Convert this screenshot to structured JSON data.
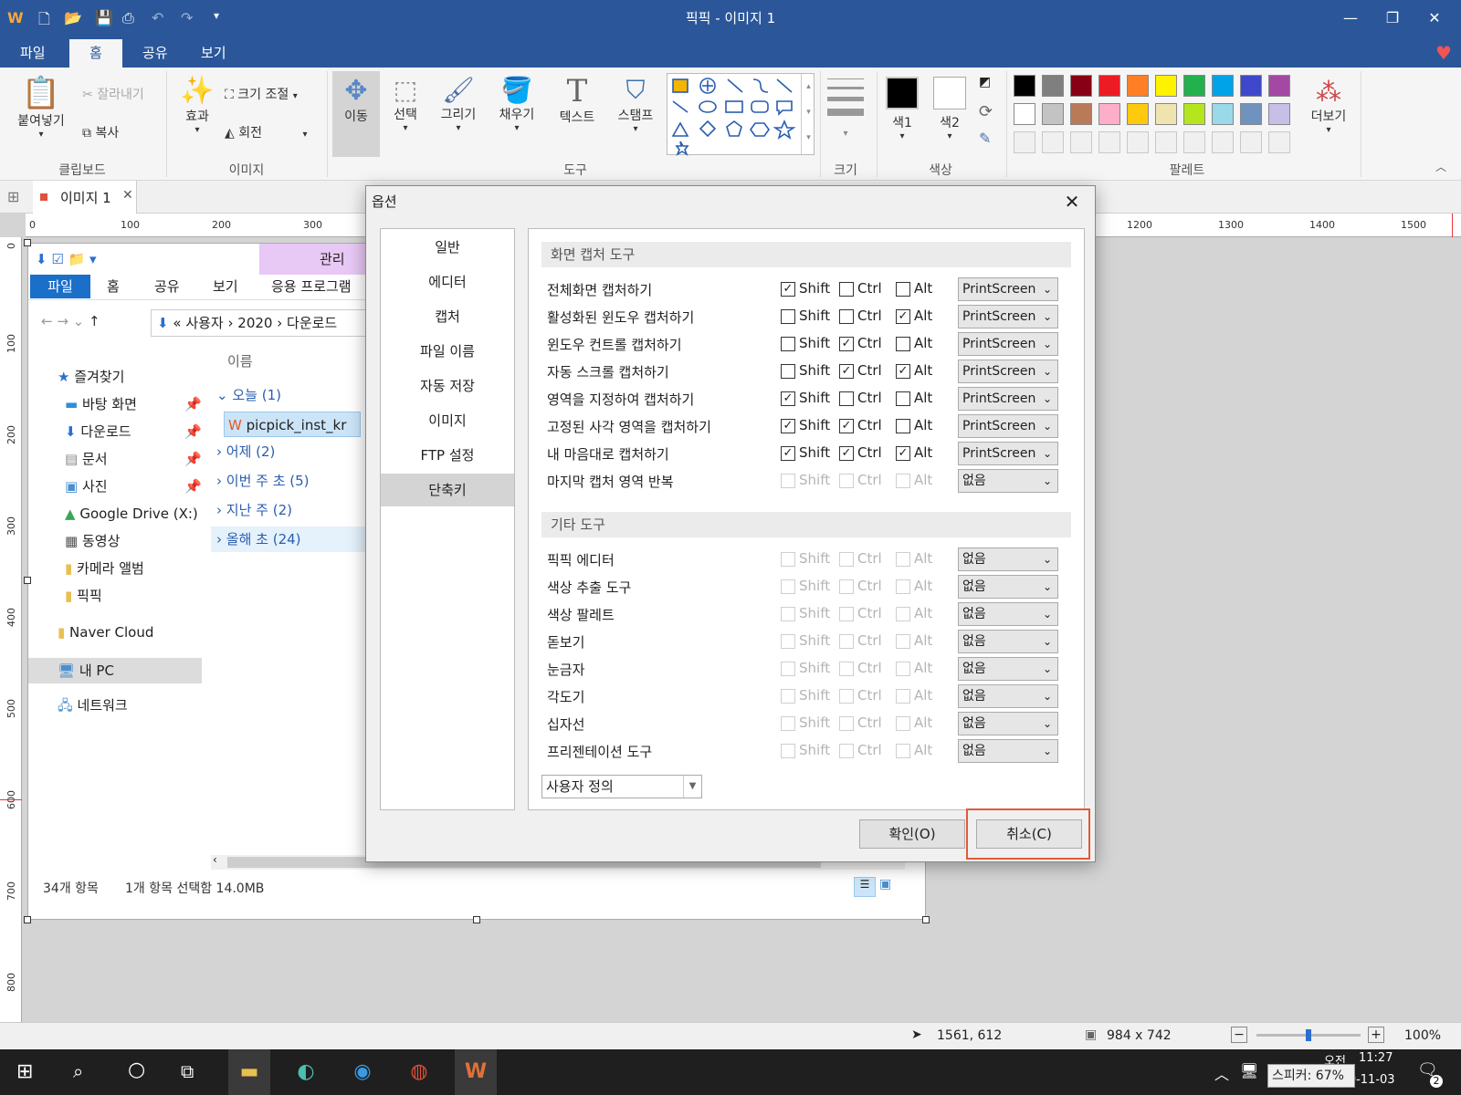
{
  "window": {
    "title": "픽픽 - 이미지 1",
    "minimize": "—",
    "restore": "❐",
    "close": "✕"
  },
  "ribbon_tabs": [
    "파일",
    "홈",
    "공유",
    "보기"
  ],
  "ribbon": {
    "clipboard": {
      "paste": "붙여넣기",
      "cut": "잘라내기",
      "copy": "복사",
      "label": "클립보드"
    },
    "image": {
      "effect": "효과",
      "resize": "크기 조절",
      "rotate": "회전",
      "label": "이미지"
    },
    "tools": {
      "move": "이동",
      "select": "선택",
      "draw": "그리기",
      "fill": "채우기",
      "text": "텍스트",
      "stamp": "스탬프",
      "label": "도구"
    },
    "size": {
      "label": "크기"
    },
    "color": {
      "color1": "색1",
      "color2": "색2",
      "label": "색상"
    },
    "palette": {
      "label": "팔레트",
      "more": "더보기",
      "row1": [
        "#000000",
        "#7f7f7f",
        "#880015",
        "#ed1c24",
        "#ff7f27",
        "#fff200",
        "#22b14c",
        "#00a2e8",
        "#3f48cc",
        "#a349a4"
      ],
      "row2": [
        "#ffffff",
        "#c3c3c3",
        "#b97a57",
        "#ffaec9",
        "#ffc90e",
        "#efe4b0",
        "#b5e61d",
        "#99d9ea",
        "#7092be",
        "#c8bfe7"
      ]
    }
  },
  "doc_tab": {
    "label": "이미지 1"
  },
  "ruler": {
    "h": [
      "0",
      "100",
      "200",
      "300",
      "1200",
      "1300",
      "1400",
      "1500"
    ],
    "v": [
      "0",
      "100",
      "200",
      "300",
      "400",
      "500",
      "600",
      "700",
      "800"
    ]
  },
  "explorer": {
    "context_tab": "관리",
    "tabs": [
      "파일",
      "홈",
      "공유",
      "보기",
      "응용 프로그램"
    ],
    "path": [
      "«",
      "사용자",
      "2020",
      "다운로드"
    ],
    "column": "이름",
    "nav": [
      "즐겨찾기",
      "바탕 화면",
      "다운로드",
      "문서",
      "사진",
      "Google Drive (X:)",
      "동영상",
      "카메라 앨범",
      "픽픽",
      "Naver Cloud",
      "내 PC",
      "네트워크"
    ],
    "groups": [
      "오늘 (1)",
      "어제 (2)",
      "이번 주 초 (5)",
      "지난 주 (2)",
      "올해 초 (24)"
    ],
    "file": "picpick_inst_kr",
    "status_count": "34개 항목",
    "status_sel": "1개 항목 선택함 14.0MB"
  },
  "dialog": {
    "title": "옵션",
    "nav": [
      "일반",
      "에디터",
      "캡처",
      "파일 이름",
      "자동 저장",
      "이미지",
      "FTP 설정",
      "단축키"
    ],
    "selected_nav": "단축키",
    "section1": "화면 캡처 도구",
    "section2": "기타 도구",
    "mod_labels": [
      "Shift",
      "Ctrl",
      "Alt"
    ],
    "capture_rows": [
      {
        "label": "전체화면 캡처하기",
        "shift": true,
        "ctrl": false,
        "alt": false,
        "key": "PrintScreen",
        "enabled": true
      },
      {
        "label": "활성화된 윈도우 캡처하기",
        "shift": false,
        "ctrl": false,
        "alt": true,
        "key": "PrintScreen",
        "enabled": true
      },
      {
        "label": "윈도우 컨트롤 캡처하기",
        "shift": false,
        "ctrl": true,
        "alt": false,
        "key": "PrintScreen",
        "enabled": true
      },
      {
        "label": "자동 스크롤 캡처하기",
        "shift": false,
        "ctrl": true,
        "alt": true,
        "key": "PrintScreen",
        "enabled": true
      },
      {
        "label": "영역을 지정하여 캡처하기",
        "shift": true,
        "ctrl": false,
        "alt": false,
        "key": "PrintScreen",
        "enabled": true
      },
      {
        "label": "고정된 사각 영역을 캡처하기",
        "shift": true,
        "ctrl": true,
        "alt": false,
        "key": "PrintScreen",
        "enabled": true
      },
      {
        "label": "내 마음대로 캡처하기",
        "shift": true,
        "ctrl": true,
        "alt": true,
        "key": "PrintScreen",
        "enabled": true
      },
      {
        "label": "마지막 캡처 영역 반복",
        "shift": false,
        "ctrl": false,
        "alt": false,
        "key": "없음",
        "enabled": false
      }
    ],
    "other_rows": [
      {
        "label": "픽픽 에디터",
        "key": "없음"
      },
      {
        "label": "색상 추출 도구",
        "key": "없음"
      },
      {
        "label": "색상 팔레트",
        "key": "없음"
      },
      {
        "label": "돋보기",
        "key": "없음"
      },
      {
        "label": "눈금자",
        "key": "없음"
      },
      {
        "label": "각도기",
        "key": "없음"
      },
      {
        "label": "십자선",
        "key": "없음"
      },
      {
        "label": "프리젠테이션 도구",
        "key": "없음"
      }
    ],
    "preset": "사용자 정의",
    "ok": "확인(O)",
    "cancel": "취소(C)"
  },
  "statusbar": {
    "cursor": "1561, 612",
    "image_size": "984 x 742",
    "zoom": "100%",
    "zoom_minus": "−",
    "zoom_plus": "+"
  },
  "taskbar": {
    "time": "11:27",
    "date": "2020-11-03",
    "tooltip": "스피커: 67%",
    "notif_count": "2",
    "time_partial": "오전"
  }
}
